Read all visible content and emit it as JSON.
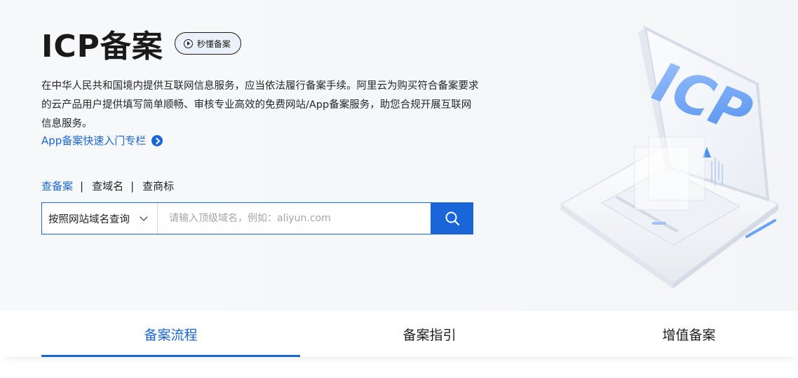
{
  "hero": {
    "title": "ICP备案",
    "video_label": "秒懂备案",
    "description": "在中华人民共和国境内提供互联网信息服务，应当依法履行备案手续。阿里云为购买符合备案要求的云产品用户提供填写简单顺畅、审核专业高效的免费网站/App备案服务，助您合规开展互联网信息服务。",
    "app_link": "App备案快速入门专栏",
    "illustration_text": "ICP"
  },
  "search": {
    "tabs": [
      {
        "label": "查备案",
        "active": true
      },
      {
        "label": "查域名",
        "active": false
      },
      {
        "label": "查商标",
        "active": false
      }
    ],
    "separator": "|",
    "select_value": "按照网站域名查询",
    "placeholder": "请输入顶级域名，例如：aliyun.com"
  },
  "bottom_tabs": [
    {
      "label": "备案流程",
      "active": true
    },
    {
      "label": "备案指引",
      "active": false
    },
    {
      "label": "增值备案",
      "active": false
    }
  ],
  "colors": {
    "accent": "#1a66d9",
    "text": "#1f1f1f",
    "hero_bg": "#f6f7f9"
  },
  "icons": {
    "video": "play-circle-icon",
    "link_arrow": "arrow-right-circle-icon",
    "select": "chevron-down-icon",
    "search": "search-icon"
  }
}
